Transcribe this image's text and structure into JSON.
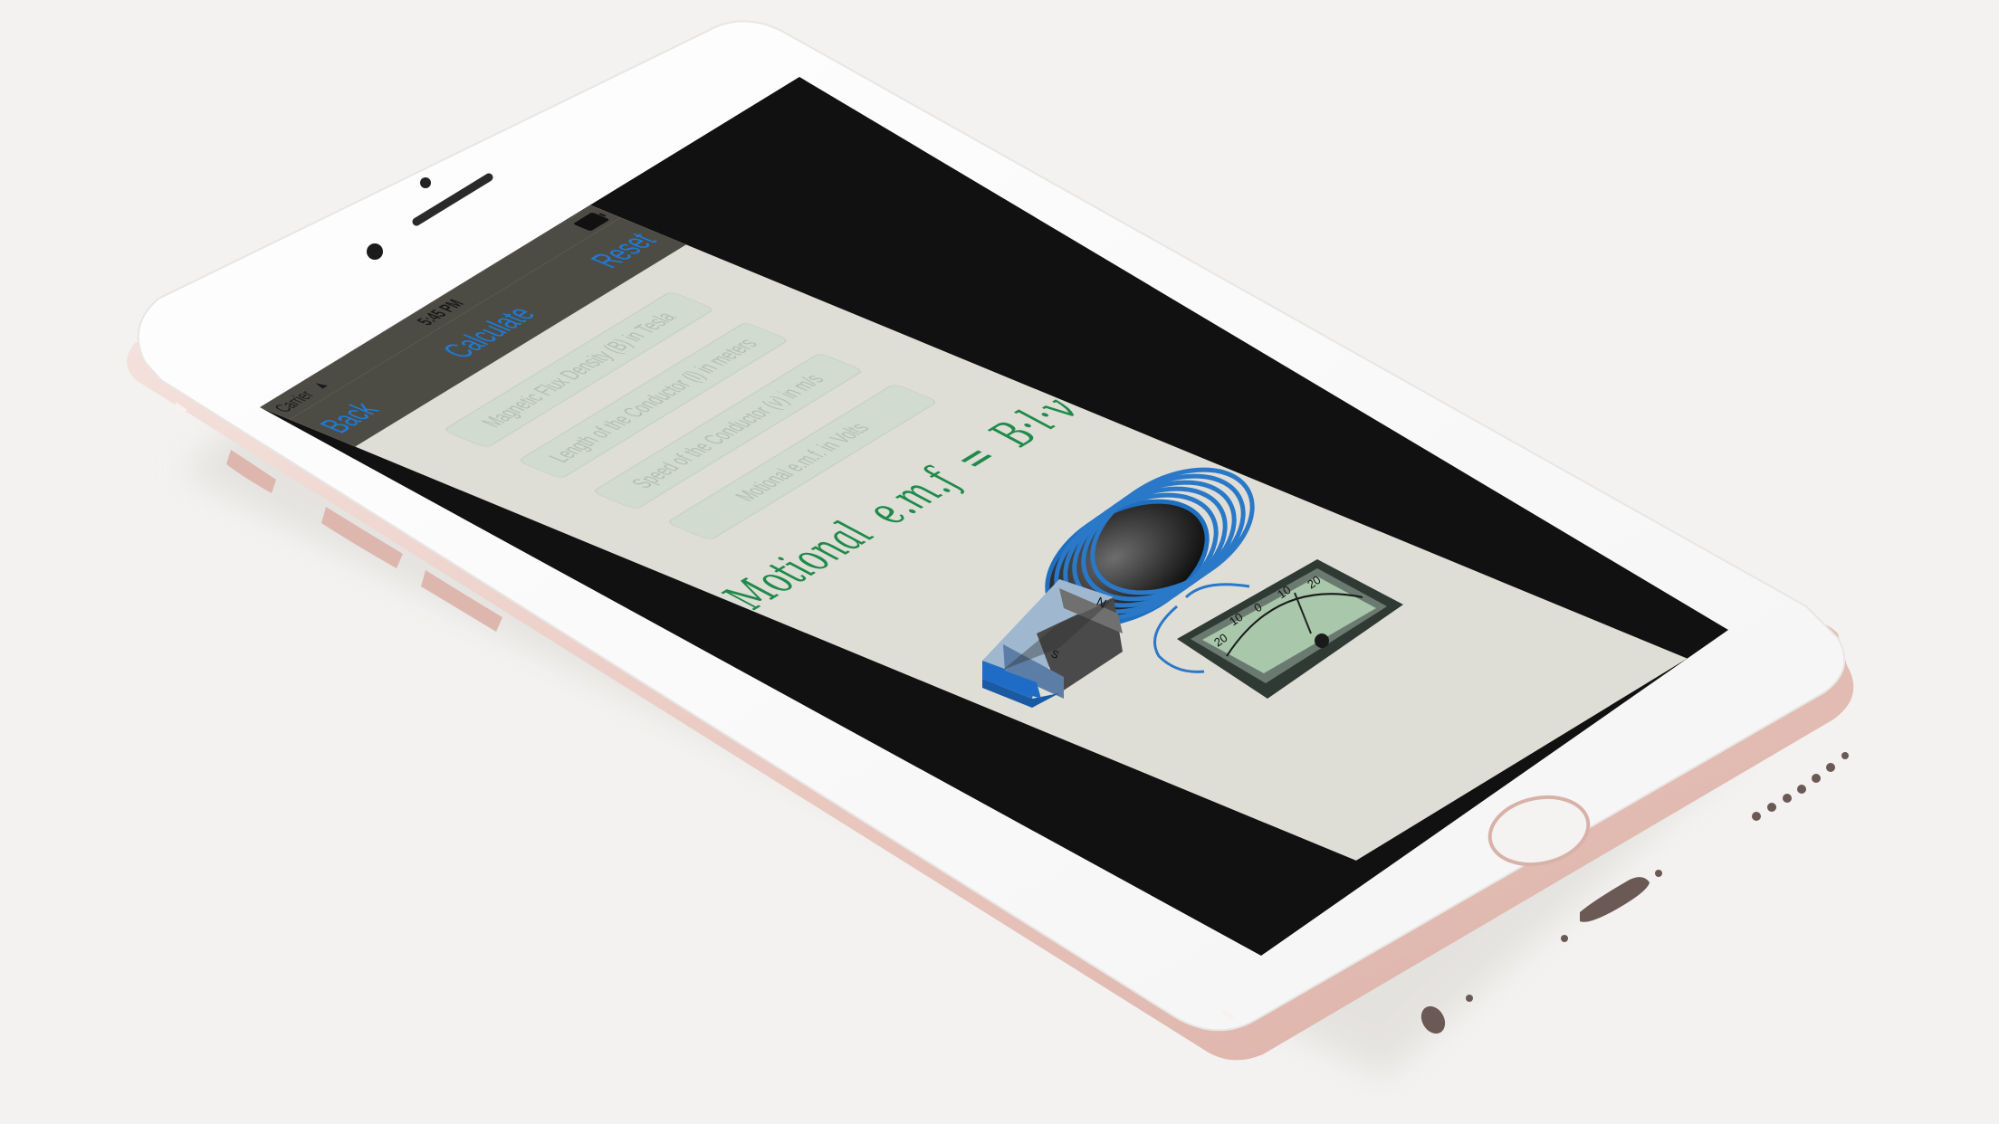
{
  "status_bar": {
    "carrier": "Carrier",
    "time": "5:45 PM"
  },
  "nav_bar": {
    "back_label": "Back",
    "title": "Calculate",
    "reset_label": "Reset"
  },
  "fields": [
    {
      "placeholder": "Magnetic Flux Density (B) in Tesla"
    },
    {
      "placeholder": "Length of the Conductor (l) in meters"
    },
    {
      "placeholder": "Speed of the Conductor (v) in m/s"
    },
    {
      "placeholder": "Motional e.m.f. in Volts"
    }
  ],
  "formula": {
    "lhs": "Motional  e.m.f  =  B·l·v"
  },
  "magnet": {
    "north_label": "N",
    "south_label": "S"
  },
  "meter": {
    "scale_labels": [
      "20",
      "10",
      "0",
      "10",
      "20"
    ]
  },
  "colors": {
    "phone_body": "#ead2cc",
    "bezel": "#ffffff",
    "screen_bg": "#dfded6",
    "nav_bg": "#4d4c44",
    "accent_blue": "#1e7bd8",
    "formula_green": "#1f8a4a"
  }
}
